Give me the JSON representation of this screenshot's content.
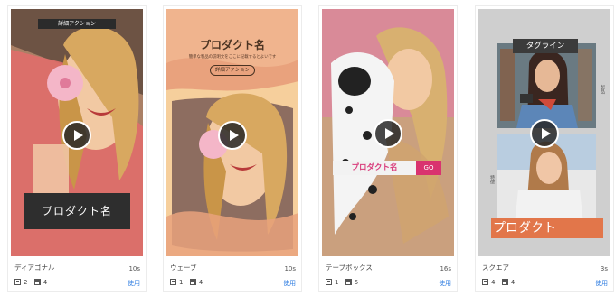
{
  "templates": [
    {
      "name": "ディアゴナル",
      "duration": "10s",
      "text_count": "2",
      "image_count": "4",
      "use_label": "使用",
      "overlay": {
        "action": "詳細アクション",
        "product_name": "プロダクト名"
      }
    },
    {
      "name": "ウェーブ",
      "duration": "10s",
      "text_count": "1",
      "image_count": "4",
      "use_label": "使用",
      "overlay": {
        "product_name": "プロダクト名",
        "subtitle": "簡単な製品の説明文をここに記載するとよいです",
        "action": "詳細アクション"
      }
    },
    {
      "name": "テーブボックス",
      "duration": "16s",
      "text_count": "1",
      "image_count": "5",
      "use_label": "使用",
      "overlay": {
        "product_name": "プロダクト名",
        "go": "GO"
      }
    },
    {
      "name": "スクエア",
      "duration": "3s",
      "text_count": "4",
      "image_count": "4",
      "use_label": "使用",
      "overlay": {
        "tagline": "タグライン",
        "side_right": "製品",
        "side_left": "特徴",
        "product_name": "プロダクト"
      }
    }
  ],
  "icons": {
    "play": "play-icon",
    "text_count": "text-layer-icon",
    "image_count": "image-layer-icon"
  },
  "colors": {
    "link": "#2f7de1",
    "diagonal_accent": "#e86c6c",
    "wave_bg": "#e9a27d",
    "tablebox_go": "#d9336f",
    "square_accent": "#e2764a"
  }
}
